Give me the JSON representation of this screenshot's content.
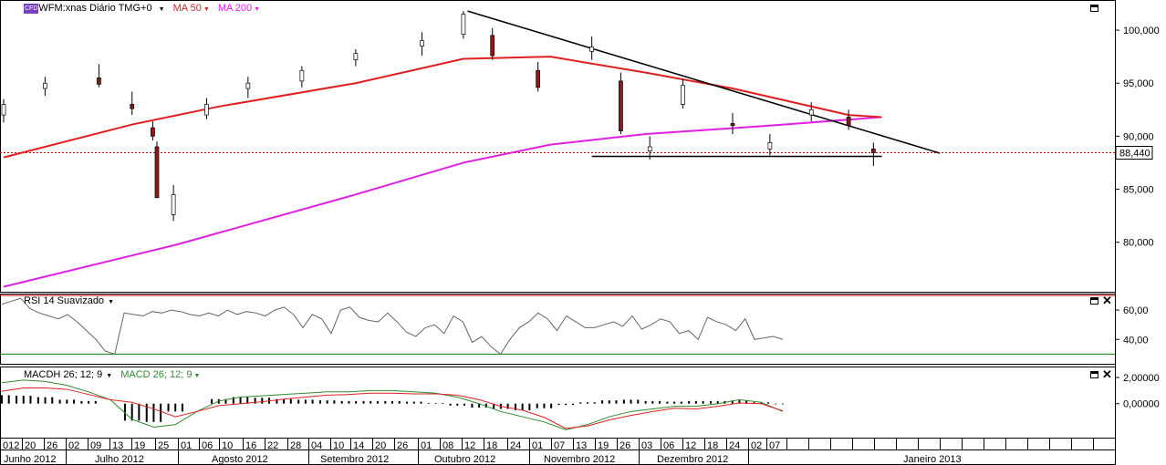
{
  "symbol_badge": "CFD",
  "main_panel": {
    "instrument": "WFM:xnas Diário TMG+0",
    "ma50_label": "MA 50",
    "ma200_label": "MA 200",
    "price_tag": "88,440",
    "y_ticks": [
      "100,000",
      "95,000",
      "90,000",
      "85,000",
      "80,000"
    ]
  },
  "rsi_panel": {
    "label": "RSI 14 Suavizado",
    "y_ticks": [
      "60,00",
      "40,00"
    ]
  },
  "macd_panel": {
    "macdh_label": "MACDH 26; 12; 9",
    "macd_label": "MACD 26; 12; 9",
    "y_ticks": [
      "2,00000",
      "0,00000"
    ]
  },
  "x_axis": {
    "days": [
      "012",
      "20",
      "26",
      "02",
      "09",
      "13",
      "19",
      "25",
      "01",
      "06",
      "10",
      "16",
      "22",
      "28",
      "04",
      "10",
      "14",
      "20",
      "26",
      "01",
      "08",
      "12",
      "18",
      "24",
      "01",
      "07",
      "13",
      "19",
      "26",
      "03",
      "06",
      "12",
      "18",
      "24",
      "02",
      "07"
    ],
    "months": [
      "Junho 2012",
      "Julho 2012",
      "Agosto 2012",
      "Setembro 2012",
      "Outubro 2012",
      "Novembro 2012",
      "Dezembro 2012",
      "Janeiro 2013"
    ]
  },
  "colors": {
    "ma50": "#e02020",
    "ma200": "#e020e0",
    "up_candle": "#ffffff",
    "down_candle": "#8b1a1a",
    "macd": "#2e8b2e",
    "signal": "#e02020",
    "rsi_upper": "#cc0000",
    "rsi_lower": "#008000",
    "support": "#cc0000"
  },
  "chart_data": [
    {
      "type": "candlestick",
      "title": "WFM:xnas Diário TMG+0",
      "ylim": [
        75.5,
        102.5
      ],
      "x_range": [
        "2012-06-12",
        "2013-01-31"
      ],
      "series": [
        {
          "name": "WFM:xnas",
          "values_ohlc_sampled": [
            [
              "2012-06-12",
              92.0,
              93.5,
              91.3,
              93.0
            ],
            [
              "2012-06-22",
              94.5,
              95.6,
              93.8,
              95.0
            ],
            [
              "2012-07-05",
              95.5,
              96.8,
              94.6,
              94.9
            ],
            [
              "2012-07-13",
              93.0,
              94.2,
              92.0,
              92.6
            ],
            [
              "2012-07-18",
              90.8,
              91.4,
              89.6,
              90.0
            ],
            [
              "2012-07-19",
              89.0,
              89.5,
              84.5,
              84.2
            ],
            [
              "2012-07-23",
              82.6,
              85.4,
              82.0,
              84.5
            ],
            [
              "2012-07-31",
              92.0,
              93.6,
              91.6,
              93.0
            ],
            [
              "2012-08-10",
              94.5,
              95.6,
              93.6,
              95.0
            ],
            [
              "2012-08-23",
              95.2,
              96.6,
              94.6,
              96.2
            ],
            [
              "2012-09-05",
              97.2,
              98.2,
              96.6,
              97.8
            ],
            [
              "2012-09-21",
              98.5,
              99.8,
              97.6,
              99.0
            ],
            [
              "2012-10-01",
              99.6,
              101.8,
              99.2,
              101.5
            ],
            [
              "2012-10-08",
              99.5,
              100.2,
              97.2,
              97.6
            ],
            [
              "2012-10-19",
              96.2,
              97.0,
              94.2,
              94.6
            ],
            [
              "2012-11-01",
              98.0,
              99.4,
              97.2,
              98.4
            ],
            [
              "2012-11-08",
              95.2,
              96.0,
              90.2,
              90.5
            ],
            [
              "2012-11-15",
              88.6,
              90.0,
              87.8,
              89.0
            ],
            [
              "2012-11-23",
              93.0,
              95.4,
              92.6,
              94.8
            ],
            [
              "2012-12-05",
              91.2,
              92.2,
              90.2,
              91.0
            ],
            [
              "2012-12-14",
              88.8,
              90.2,
              88.2,
              89.4
            ],
            [
              "2012-12-24",
              92.0,
              93.2,
              91.4,
              92.5
            ],
            [
              "2013-01-02",
              91.8,
              92.5,
              90.6,
              91.0
            ],
            [
              "2013-01-08",
              88.8,
              89.4,
              87.2,
              88.44
            ]
          ]
        },
        {
          "name": "MA 50",
          "x": [
            "2012-06-12",
            "2012-07-13",
            "2012-08-03",
            "2012-09-05",
            "2012-10-01",
            "2012-10-22",
            "2012-11-14",
            "2012-12-05",
            "2013-01-02",
            "2013-01-10"
          ],
          "values": [
            88.0,
            91.1,
            92.8,
            95.0,
            97.3,
            97.5,
            96.0,
            94.5,
            92.0,
            91.8
          ]
        },
        {
          "name": "MA 200",
          "x": [
            "2012-06-12",
            "2012-07-24",
            "2012-09-05",
            "2012-10-01",
            "2012-10-22",
            "2012-11-14",
            "2012-12-14",
            "2013-01-10"
          ],
          "values": [
            75.8,
            79.8,
            84.5,
            87.5,
            89.2,
            90.2,
            91.0,
            91.8
          ]
        }
      ],
      "trendline_resistance": [
        [
          "2012-10-02",
          101.8
        ],
        [
          "2013-01-24",
          88.4
        ]
      ],
      "support_line": {
        "x": [
          "2012-11-01",
          "2013-01-10"
        ],
        "value": 88.1
      },
      "current_price": 88.44
    },
    {
      "type": "line",
      "title": "RSI 14 Suavizado",
      "ylim": [
        24,
        70
      ],
      "thresholds": [
        70,
        30
      ],
      "series": [
        {
          "name": "RSI 14 Suavizado",
          "values": [
            64,
            66,
            68,
            61,
            58,
            56,
            54,
            57,
            52,
            46,
            40,
            32,
            30,
            58,
            57,
            56,
            59,
            58,
            60,
            59,
            57,
            56,
            58,
            56,
            60,
            57,
            59,
            58,
            56,
            60,
            62,
            57,
            48,
            57,
            54,
            44,
            60,
            62,
            55,
            53,
            52,
            58,
            52,
            45,
            42,
            48,
            50,
            44,
            56,
            52,
            38,
            42,
            35,
            30,
            40,
            48,
            52,
            58,
            54,
            46,
            56,
            52,
            48,
            48,
            50,
            52,
            49,
            56,
            47,
            50,
            54,
            52,
            44,
            46,
            40,
            55,
            52,
            50,
            46,
            54,
            40,
            41,
            42,
            40
          ]
        }
      ]
    },
    {
      "type": "line",
      "title": "MACD 26; 12; 9",
      "ylim": [
        -2.6,
        2.7
      ],
      "series": [
        {
          "name": "MACD 26; 12; 9",
          "values": [
            1.6,
            1.8,
            1.7,
            1.4,
            0.9,
            0.3,
            -1.2,
            -1.8,
            -1.6,
            -0.6,
            0.2,
            0.5,
            0.6,
            0.7,
            0.8,
            0.9,
            0.9,
            1.0,
            1.0,
            0.9,
            0.8,
            0.5,
            0.0,
            -0.6,
            -1.0,
            -1.4,
            -2.0,
            -1.6,
            -1.0,
            -0.6,
            -0.4,
            -0.2,
            -0.2,
            0.0,
            0.3,
            0.1,
            -0.6
          ]
        },
        {
          "name": "MACDH 26; 12; 9",
          "values": [
            0.65,
            0.6,
            0.5,
            0.3,
            0.2,
            0.0,
            -1.3,
            -1.4,
            -0.6,
            0.0,
            0.35,
            0.5,
            0.45,
            0.35,
            0.3,
            0.25,
            0.2,
            0.2,
            0.2,
            0.15,
            0.05,
            -0.15,
            -0.3,
            -0.4,
            -0.5,
            -0.35,
            -0.1,
            0.1,
            0.25,
            0.3,
            0.2,
            0.15,
            0.2,
            0.2,
            0.25,
            0.1,
            -0.05
          ]
        }
      ]
    }
  ]
}
